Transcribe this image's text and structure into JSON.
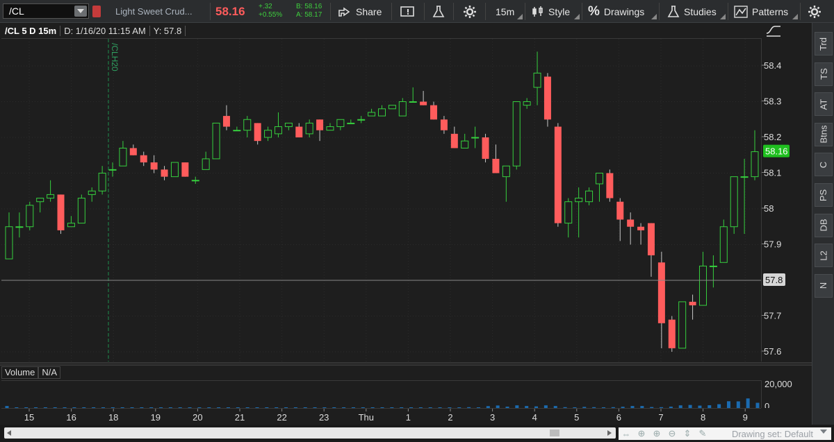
{
  "toolbar": {
    "symbol": "/CL",
    "description": "Light Sweet Crud...",
    "last": "58.16",
    "change": "+.32",
    "change_pct": "+0.55%",
    "bid": "B: 58.16",
    "ask": "A: 58.17",
    "share": "Share",
    "timeframe": "15m",
    "style": "Style",
    "drawings": "Drawings",
    "studies": "Studies",
    "patterns": "Patterns"
  },
  "header": {
    "symbol_period": "/CL 5 D 15m",
    "date": "D: 1/16/20 11:15 AM",
    "y": "Y: 57.8"
  },
  "marker": {
    "label": "/CLH20"
  },
  "price_axis": {
    "ticks": [
      "58.4",
      "58.3",
      "58.2",
      "58.1",
      "58",
      "57.9",
      "57.8",
      "57.7",
      "57.6"
    ],
    "last_label": "58.16",
    "cursor_label": "57.8"
  },
  "volume": {
    "label": "Volume",
    "value": "N/A",
    "axis_top": "20,000",
    "axis_bottom": "0"
  },
  "time_axis": {
    "labels": [
      "15",
      "16",
      "18",
      "19",
      "20",
      "21",
      "22",
      "23",
      "Thu",
      "1",
      "2",
      "3",
      "4",
      "5",
      "6",
      "7",
      "8",
      "9"
    ]
  },
  "side_tabs": [
    "Trd",
    "TS",
    "AT",
    "Btns",
    "C",
    "PS",
    "DB",
    "L2",
    "N"
  ],
  "bottom": {
    "drawing_set": "Drawing set: Default"
  },
  "colors": {
    "up": "#36d03e",
    "down": "#ff5c5c",
    "background": "#1e1e1e",
    "last_badge": "#1fbf1f"
  },
  "chart_data": {
    "type": "candlestick",
    "ylim": [
      57.56,
      58.5
    ],
    "candles": [
      {
        "o": 57.86,
        "h": 57.99,
        "l": 57.86,
        "c": 57.95
      },
      {
        "o": 57.95,
        "h": 57.99,
        "l": 57.92,
        "c": 57.95
      },
      {
        "o": 57.95,
        "h": 58.02,
        "l": 57.94,
        "c": 58.01
      },
      {
        "o": 58.02,
        "h": 58.03,
        "l": 57.99,
        "c": 58.03
      },
      {
        "o": 58.03,
        "h": 58.08,
        "l": 58.02,
        "c": 58.04
      },
      {
        "o": 58.04,
        "h": 58.04,
        "l": 57.93,
        "c": 57.94
      },
      {
        "o": 57.95,
        "h": 57.98,
        "l": 57.95,
        "c": 57.96
      },
      {
        "o": 57.96,
        "h": 58.04,
        "l": 57.96,
        "c": 58.03
      },
      {
        "o": 58.04,
        "h": 58.06,
        "l": 58.02,
        "c": 58.05
      },
      {
        "o": 58.05,
        "h": 58.12,
        "l": 58.04,
        "c": 58.1
      },
      {
        "o": 58.11,
        "h": 58.13,
        "l": 58.09,
        "c": 58.11
      },
      {
        "o": 58.12,
        "h": 58.19,
        "l": 58.12,
        "c": 58.17
      },
      {
        "o": 58.17,
        "h": 58.18,
        "l": 58.15,
        "c": 58.15
      },
      {
        "o": 58.15,
        "h": 58.16,
        "l": 58.12,
        "c": 58.13
      },
      {
        "o": 58.13,
        "h": 58.15,
        "l": 58.1,
        "c": 58.11
      },
      {
        "o": 58.11,
        "h": 58.12,
        "l": 58.08,
        "c": 58.09
      },
      {
        "o": 58.09,
        "h": 58.13,
        "l": 58.09,
        "c": 58.13
      },
      {
        "o": 58.13,
        "h": 58.13,
        "l": 58.09,
        "c": 58.09
      },
      {
        "o": 58.08,
        "h": 58.09,
        "l": 58.07,
        "c": 58.08
      },
      {
        "o": 58.11,
        "h": 58.16,
        "l": 58.11,
        "c": 58.14
      },
      {
        "o": 58.14,
        "h": 58.24,
        "l": 58.14,
        "c": 58.24
      },
      {
        "o": 58.26,
        "h": 58.29,
        "l": 58.22,
        "c": 58.23
      },
      {
        "o": 58.22,
        "h": 58.23,
        "l": 58.22,
        "c": 58.22
      },
      {
        "o": 58.22,
        "h": 58.26,
        "l": 58.2,
        "c": 58.25
      },
      {
        "o": 58.24,
        "h": 58.24,
        "l": 58.18,
        "c": 58.19
      },
      {
        "o": 58.2,
        "h": 58.23,
        "l": 58.19,
        "c": 58.22
      },
      {
        "o": 58.21,
        "h": 58.27,
        "l": 58.2,
        "c": 58.23
      },
      {
        "o": 58.23,
        "h": 58.24,
        "l": 58.22,
        "c": 58.24
      },
      {
        "o": 58.23,
        "h": 58.24,
        "l": 58.2,
        "c": 58.2
      },
      {
        "o": 58.21,
        "h": 58.25,
        "l": 58.2,
        "c": 58.24
      },
      {
        "o": 58.25,
        "h": 58.25,
        "l": 58.19,
        "c": 58.22
      },
      {
        "o": 58.22,
        "h": 58.24,
        "l": 58.22,
        "c": 58.23
      },
      {
        "o": 58.23,
        "h": 58.25,
        "l": 58.22,
        "c": 58.25
      },
      {
        "o": 58.24,
        "h": 58.25,
        "l": 58.24,
        "c": 58.24
      },
      {
        "o": 58.25,
        "h": 58.26,
        "l": 58.24,
        "c": 58.25
      },
      {
        "o": 58.26,
        "h": 58.28,
        "l": 58.26,
        "c": 58.27
      },
      {
        "o": 58.26,
        "h": 58.29,
        "l": 58.26,
        "c": 58.28
      },
      {
        "o": 58.28,
        "h": 58.29,
        "l": 58.28,
        "c": 58.29
      },
      {
        "o": 58.26,
        "h": 58.31,
        "l": 58.26,
        "c": 58.3
      },
      {
        "o": 58.3,
        "h": 58.34,
        "l": 58.3,
        "c": 58.3
      },
      {
        "o": 58.3,
        "h": 58.33,
        "l": 58.29,
        "c": 58.29
      },
      {
        "o": 58.29,
        "h": 58.3,
        "l": 58.25,
        "c": 58.25
      },
      {
        "o": 58.25,
        "h": 58.26,
        "l": 58.21,
        "c": 58.22
      },
      {
        "o": 58.21,
        "h": 58.23,
        "l": 58.17,
        "c": 58.17
      },
      {
        "o": 58.17,
        "h": 58.21,
        "l": 58.17,
        "c": 58.19
      },
      {
        "o": 58.2,
        "h": 58.23,
        "l": 58.17,
        "c": 58.2
      },
      {
        "o": 58.2,
        "h": 58.21,
        "l": 58.13,
        "c": 58.14
      },
      {
        "o": 58.14,
        "h": 58.18,
        "l": 58.1,
        "c": 58.1
      },
      {
        "o": 58.09,
        "h": 58.12,
        "l": 58.02,
        "c": 58.12
      },
      {
        "o": 58.12,
        "h": 58.23,
        "l": 58.11,
        "c": 58.3
      },
      {
        "o": 58.29,
        "h": 58.31,
        "l": 58.28,
        "c": 58.3
      },
      {
        "o": 58.34,
        "h": 58.44,
        "l": 58.29,
        "c": 58.38
      },
      {
        "o": 58.37,
        "h": 58.38,
        "l": 58.23,
        "c": 58.25
      },
      {
        "o": 58.23,
        "h": 58.24,
        "l": 57.95,
        "c": 57.96
      },
      {
        "o": 57.96,
        "h": 58.03,
        "l": 57.92,
        "c": 58.02
      },
      {
        "o": 58.02,
        "h": 58.06,
        "l": 57.92,
        "c": 58.03
      },
      {
        "o": 58.02,
        "h": 58.06,
        "l": 58.01,
        "c": 58.05
      },
      {
        "o": 58.07,
        "h": 58.09,
        "l": 58.02,
        "c": 58.1
      },
      {
        "o": 58.1,
        "h": 58.11,
        "l": 58.02,
        "c": 58.03
      },
      {
        "o": 58.02,
        "h": 58.03,
        "l": 57.91,
        "c": 57.97
      },
      {
        "o": 57.97,
        "h": 57.99,
        "l": 57.9,
        "c": 57.95
      },
      {
        "o": 57.95,
        "h": 57.96,
        "l": 57.9,
        "c": 57.94
      },
      {
        "o": 57.96,
        "h": 57.96,
        "l": 57.81,
        "c": 57.87
      },
      {
        "o": 57.85,
        "h": 57.88,
        "l": 57.61,
        "c": 57.68
      },
      {
        "o": 57.69,
        "h": 57.7,
        "l": 57.6,
        "c": 57.61
      },
      {
        "o": 57.61,
        "h": 57.74,
        "l": 57.61,
        "c": 57.74
      },
      {
        "o": 57.74,
        "h": 57.76,
        "l": 57.69,
        "c": 57.73
      },
      {
        "o": 57.73,
        "h": 57.88,
        "l": 57.73,
        "c": 57.84
      },
      {
        "o": 57.84,
        "h": 57.87,
        "l": 57.78,
        "c": 57.84
      },
      {
        "o": 57.85,
        "h": 57.97,
        "l": 57.85,
        "c": 57.95
      },
      {
        "o": 57.95,
        "h": 58.09,
        "l": 57.93,
        "c": 58.09
      },
      {
        "o": 58.09,
        "h": 58.14,
        "l": 57.93,
        "c": 58.09
      },
      {
        "o": 58.09,
        "h": 58.22,
        "l": 58.08,
        "c": 58.16
      }
    ],
    "volume_ymax": 20000,
    "volume": [
      2100,
      500,
      400,
      400,
      700,
      900,
      300,
      400,
      400,
      700,
      500,
      500,
      300,
      300,
      200,
      300,
      200,
      200,
      200,
      300,
      500,
      500,
      300,
      500,
      300,
      500,
      300,
      600,
      300,
      500,
      400,
      400,
      300,
      400,
      400,
      500,
      300,
      300,
      300,
      500,
      700,
      600,
      700,
      600,
      1000,
      900,
      900,
      1000,
      1200,
      1000,
      2000,
      2500,
      1600,
      2600,
      2100,
      1800,
      2600,
      2100,
      1200,
      1100,
      1400,
      1200,
      1100,
      1200,
      1500,
      2100,
      2100,
      1300,
      1200,
      1600,
      2600,
      2900,
      2400,
      2700,
      3500,
      5800,
      5700,
      8000,
      4600
    ]
  }
}
